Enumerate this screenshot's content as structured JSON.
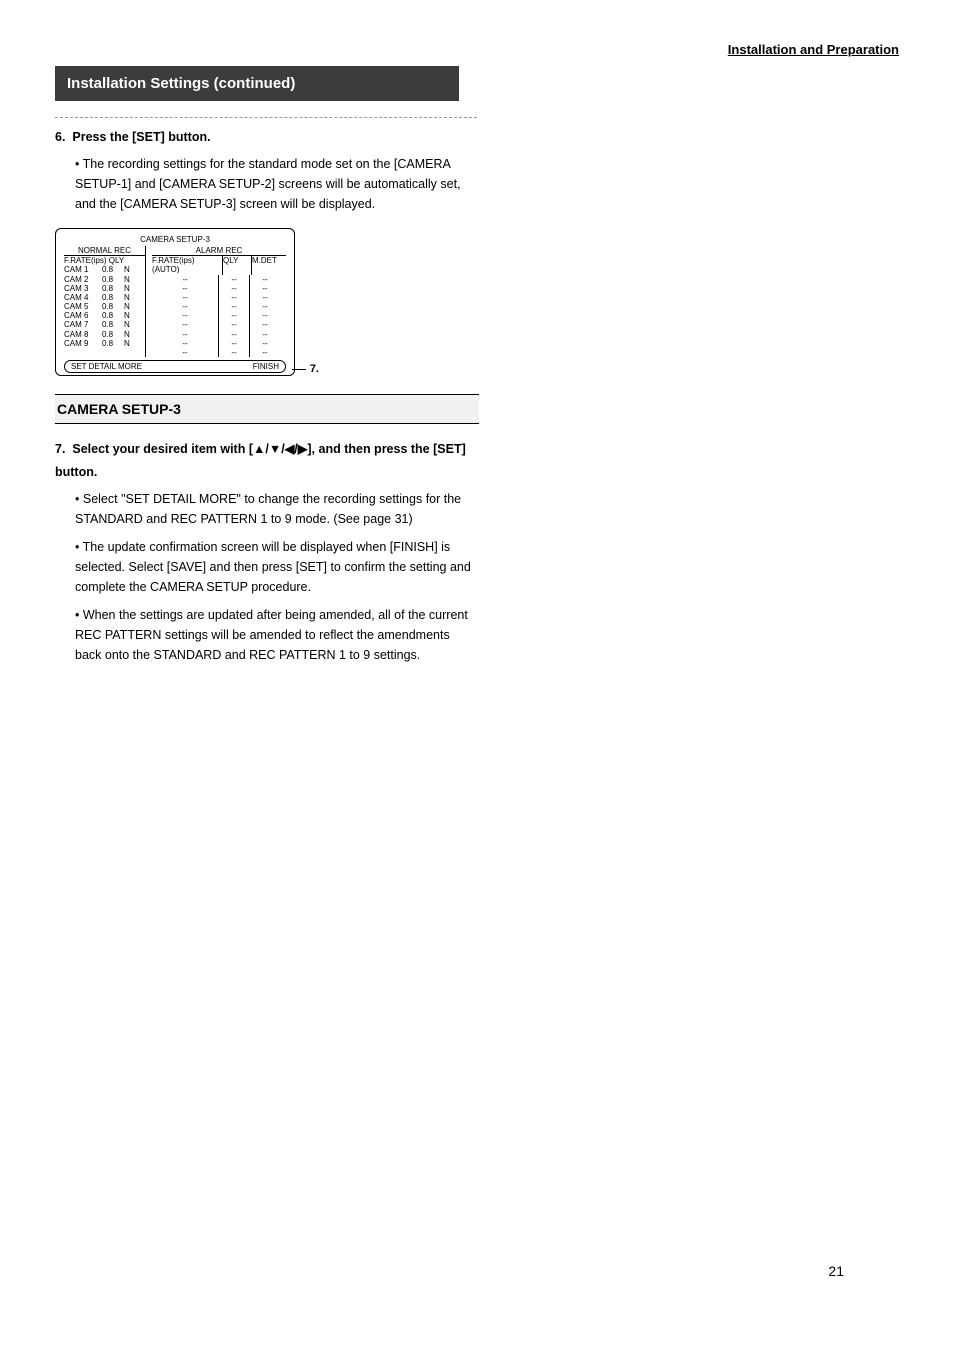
{
  "header": {
    "section_title": "Installation and Preparation"
  },
  "title_bar": "Installation Settings (continued)",
  "step6": {
    "number": "6.",
    "text": "Press the [SET] button.",
    "bullet1": "The recording settings for the standard mode set on the [CAMERA SETUP-1] and [CAMERA SETUP-2] screens will be automatically set, and the [CAMERA SETUP-3] screen will be displayed."
  },
  "diagram": {
    "title": "CAMERA SETUP-3",
    "normal_head": "NORMAL REC",
    "alarm_head": "ALARM REC",
    "normal_sub": "F.RATE(ips)  QLY",
    "alarm_sub_rate": "F.RATE(ips) (AUTO)",
    "alarm_sub_qly": "QLY",
    "alarm_sub_mdet": "M.DET",
    "rows": [
      {
        "name": "CAM 1",
        "rate": "0.8",
        "qly": "N"
      },
      {
        "name": "CAM 2",
        "rate": "0.8",
        "qly": "N"
      },
      {
        "name": "CAM 3",
        "rate": "0.8",
        "qly": "N"
      },
      {
        "name": "CAM 4",
        "rate": "0.8",
        "qly": "N"
      },
      {
        "name": "CAM 5",
        "rate": "0.8",
        "qly": "N"
      },
      {
        "name": "CAM 6",
        "rate": "0.8",
        "qly": "N"
      },
      {
        "name": "CAM 7",
        "rate": "0.8",
        "qly": "N"
      },
      {
        "name": "CAM 8",
        "rate": "0.8",
        "qly": "N"
      },
      {
        "name": "CAM 9",
        "rate": "0.8",
        "qly": "N"
      }
    ],
    "dash": "--",
    "footer_left": "SET DETAIL MORE",
    "footer_right": "FINISH",
    "callout": "7."
  },
  "section_heading": "CAMERA SETUP-3",
  "step7": {
    "number": "7.",
    "text_before": "Select your desired item with [",
    "arrows": "▲/▼/◀/▶",
    "text_after": "], and then press the [SET] button.",
    "bullet1": "Select \"SET DETAIL MORE\" to change the recording settings for the STANDARD and REC PATTERN 1 to 9 mode. (See page 31)",
    "bullet2": "The update confirmation screen will be displayed when [FINISH] is selected. Select [SAVE] and then press [SET] to confirm the setting and complete the CAMERA SETUP procedure.",
    "bullet3": "When the settings are updated after being amended, all of the current REC PATTERN settings will be amended to reflect the amendments back onto the STANDARD and REC PATTERN 1 to 9 settings."
  },
  "page_number": "21"
}
